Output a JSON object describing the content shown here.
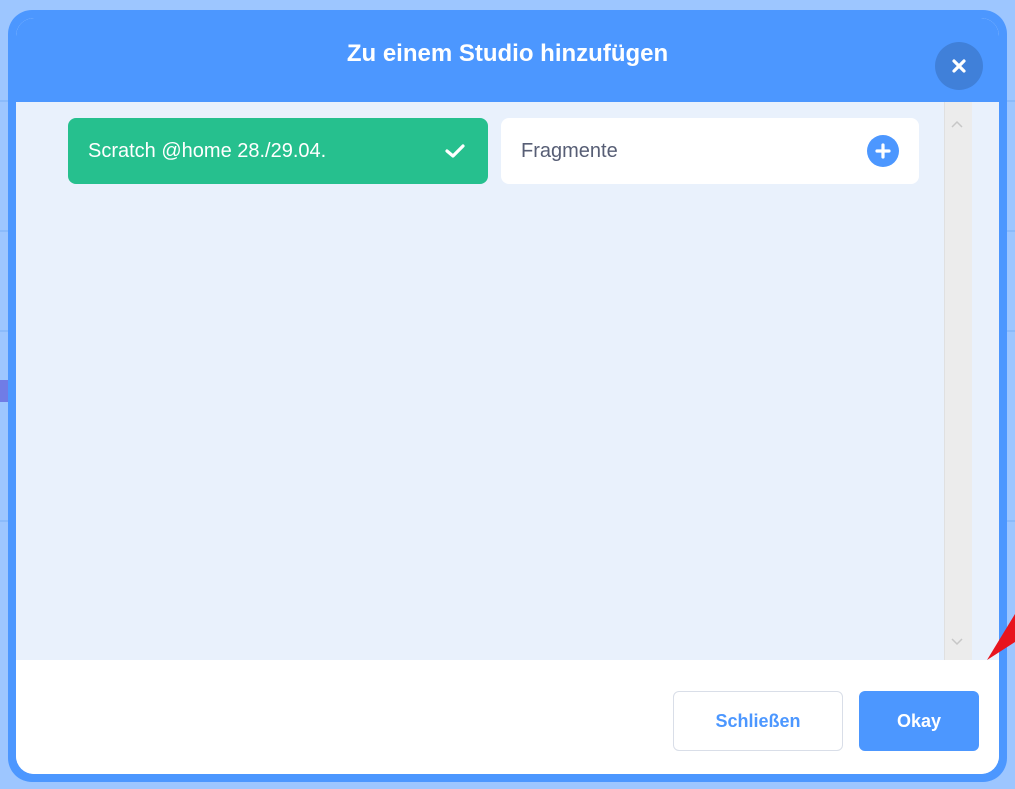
{
  "modal": {
    "title": "Zu einem Studio hinzufügen",
    "close_icon": "close-icon"
  },
  "studios": [
    {
      "label": "Scratch @home 28./29.04.",
      "selected": true,
      "icon": "check-icon"
    },
    {
      "label": "Fragmente",
      "selected": false,
      "icon": "plus-icon"
    }
  ],
  "footer": {
    "close_label": "Schließen",
    "okay_label": "Okay"
  },
  "colors": {
    "brand_blue": "#4c97ff",
    "selected_green": "#26c08e",
    "content_bg": "#e9f1fc",
    "annotation_red": "#e8141d"
  }
}
